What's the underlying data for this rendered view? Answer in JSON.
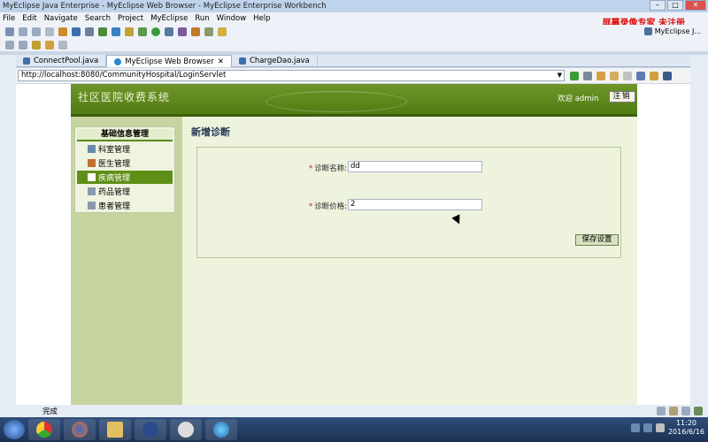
{
  "window": {
    "title": "MyEclipse Java Enterprise - MyEclipse Web Browser - MyEclipse Enterprise Workbench"
  },
  "menu": [
    "File",
    "Edit",
    "Navigate",
    "Search",
    "Project",
    "MyEclipse",
    "Run",
    "Window",
    "Help"
  ],
  "watermark": "屏幕录像专家 未注册",
  "perspective": "MyEclipse J...",
  "tabs": [
    {
      "label": "ConnectPool.java"
    },
    {
      "label": "MyEclipse Web Browser",
      "close": "✕"
    },
    {
      "label": "ChargeDao.java"
    }
  ],
  "browser": {
    "url": "http://localhost:8080/CommunityHospital/LoginServlet"
  },
  "app": {
    "title": "社区医院收费系统",
    "welcome": "欢迎 admin",
    "logout": "注销",
    "sidebar": {
      "heading": "基础信息管理",
      "items": [
        "科室管理",
        "医生管理",
        "疾病管理",
        "药品管理",
        "患者管理"
      ],
      "active_index": 2
    },
    "form": {
      "title": "新增诊断",
      "name_label": "诊断名称:",
      "name_value": "dd",
      "price_label": "诊断价格:",
      "price_value": "2",
      "required_mark": "*",
      "save": "保存设置"
    }
  },
  "status": {
    "text": "完成"
  },
  "clock": {
    "time": "11:20",
    "date": "2016/6/16"
  },
  "colors": {
    "header": "#5a8a1a",
    "active": "#5f8f17",
    "watermark": "#e01010"
  }
}
